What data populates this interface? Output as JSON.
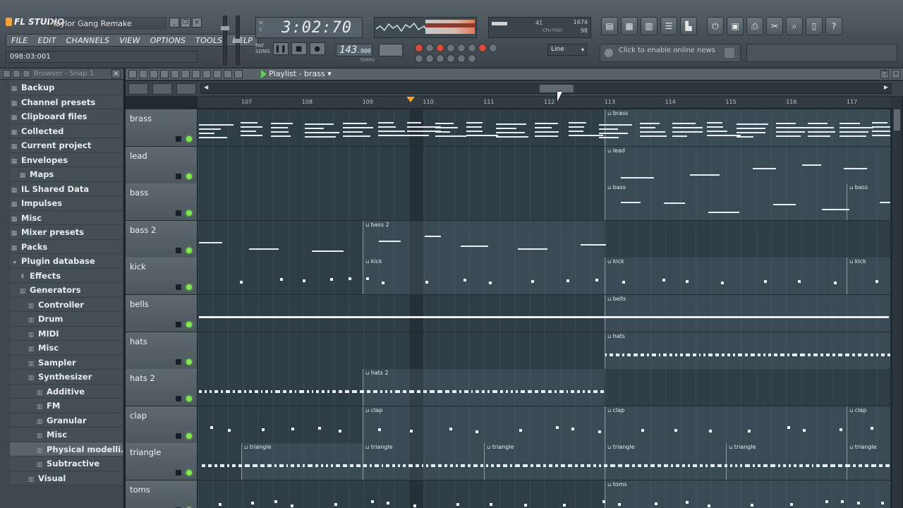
{
  "app": {
    "logo": "FL STUDIO",
    "project_title": "Taylor Gang Remake",
    "position_readout": "098:03:001",
    "menu": [
      "FILE",
      "EDIT",
      "CHANNELS",
      "VIEW",
      "OPTIONS",
      "TOOLS",
      "HELP"
    ]
  },
  "transport": {
    "time": "3:02:70",
    "tempo": "143",
    "tempo_dec": ".000",
    "tempo_label": "TEMPO",
    "snap": "Line",
    "pat_label": "PAT",
    "song_label": "SONG"
  },
  "monitor": {
    "cpu_left": "41",
    "cpu_right": "1674",
    "polyphony": "98",
    "cpu_label": "CPU",
    "poly_label": "POLY"
  },
  "online_news": "Click to enable online news",
  "browser": {
    "title": "Browser - Snap 1",
    "items": [
      {
        "label": "Backup",
        "level": 0,
        "sym": "▦"
      },
      {
        "label": "Channel presets",
        "level": 0,
        "sym": "▦"
      },
      {
        "label": "Clipboard files",
        "level": 0,
        "sym": "▦"
      },
      {
        "label": "Collected",
        "level": 0,
        "sym": "▦"
      },
      {
        "label": "Current project",
        "level": 0,
        "sym": "▦"
      },
      {
        "label": "Envelopes",
        "level": 0,
        "sym": "▦"
      },
      {
        "label": "Maps",
        "level": 1,
        "sym": "▦"
      },
      {
        "label": "IL Shared Data",
        "level": 0,
        "sym": "▦"
      },
      {
        "label": "Impulses",
        "level": 0,
        "sym": "▦"
      },
      {
        "label": "Misc",
        "level": 0,
        "sym": "▦"
      },
      {
        "label": "Mixer presets",
        "level": 0,
        "sym": "▦"
      },
      {
        "label": "Packs",
        "level": 0,
        "sym": "▦"
      },
      {
        "label": "Plugin database",
        "level": 0,
        "sym": "◂"
      },
      {
        "label": "Effects",
        "level": 1,
        "sym": "↟"
      },
      {
        "label": "Generators",
        "level": 1,
        "sym": "▥"
      },
      {
        "label": "Controller",
        "level": 2,
        "sym": "▥"
      },
      {
        "label": "Drum",
        "level": 2,
        "sym": "▥"
      },
      {
        "label": "MIDI",
        "level": 2,
        "sym": "▥"
      },
      {
        "label": "Misc",
        "level": 2,
        "sym": "▥"
      },
      {
        "label": "Sampler",
        "level": 2,
        "sym": "▥"
      },
      {
        "label": "Synthesizer",
        "level": 2,
        "sym": "▥"
      },
      {
        "label": "Additive",
        "level": 3,
        "sym": "▥"
      },
      {
        "label": "FM",
        "level": 3,
        "sym": "▥"
      },
      {
        "label": "Granular",
        "level": 3,
        "sym": "▥"
      },
      {
        "label": "Misc",
        "level": 3,
        "sym": "▥"
      },
      {
        "label": "Physical modelli...",
        "level": 3,
        "sym": "▥",
        "selected": true
      },
      {
        "label": "Subtractive",
        "level": 3,
        "sym": "▥"
      },
      {
        "label": "Visual",
        "level": 2,
        "sym": "▥"
      }
    ]
  },
  "playlist": {
    "title": "Playlist - brass",
    "bars": [
      "107",
      "108",
      "109",
      "110",
      "111",
      "112",
      "113",
      "114",
      "115",
      "116",
      "117"
    ],
    "tracks": [
      {
        "name": "brass",
        "clips": [
          {
            "label": "brass",
            "start": 577,
            "end": 982
          }
        ]
      },
      {
        "name": "lead",
        "clips": [
          {
            "label": "lead",
            "start": 577,
            "end": 982
          }
        ]
      },
      {
        "name": "bass",
        "clips": [
          {
            "label": "bass",
            "start": 577,
            "end": 920
          },
          {
            "label": "bass",
            "start": 920,
            "end": 982
          }
        ]
      },
      {
        "name": "bass 2",
        "clips": [
          {
            "label": "bass 2",
            "start": 234,
            "end": 577
          }
        ]
      },
      {
        "name": "kick",
        "clips": [
          {
            "label": "kick",
            "start": 234,
            "end": 577
          },
          {
            "label": "kick",
            "start": 577,
            "end": 920
          },
          {
            "label": "kick",
            "start": 920,
            "end": 982
          }
        ]
      },
      {
        "name": "bells",
        "clips": [
          {
            "label": "bells",
            "start": 577,
            "end": 982
          }
        ]
      },
      {
        "name": "hats",
        "clips": [
          {
            "label": "hats",
            "start": 577,
            "end": 982
          }
        ]
      },
      {
        "name": "hats 2",
        "clips": [
          {
            "label": "hats 2",
            "start": 234,
            "end": 577
          }
        ]
      },
      {
        "name": "clap",
        "clips": [
          {
            "label": "clap",
            "start": 234,
            "end": 577
          },
          {
            "label": "clap",
            "start": 577,
            "end": 920
          },
          {
            "label": "clap",
            "start": 920,
            "end": 982
          }
        ]
      },
      {
        "name": "triangle",
        "clips": [
          {
            "label": "triangle",
            "start": 62,
            "end": 234
          },
          {
            "label": "triangle",
            "start": 234,
            "end": 406
          },
          {
            "label": "triangle",
            "start": 406,
            "end": 577
          },
          {
            "label": "triangle",
            "start": 577,
            "end": 749
          },
          {
            "label": "triangle",
            "start": 749,
            "end": 920
          },
          {
            "label": "triangle",
            "start": 920,
            "end": 982
          }
        ]
      },
      {
        "name": "toms",
        "clips": [
          {
            "label": "toms",
            "start": 577,
            "end": 982
          }
        ]
      }
    ]
  }
}
